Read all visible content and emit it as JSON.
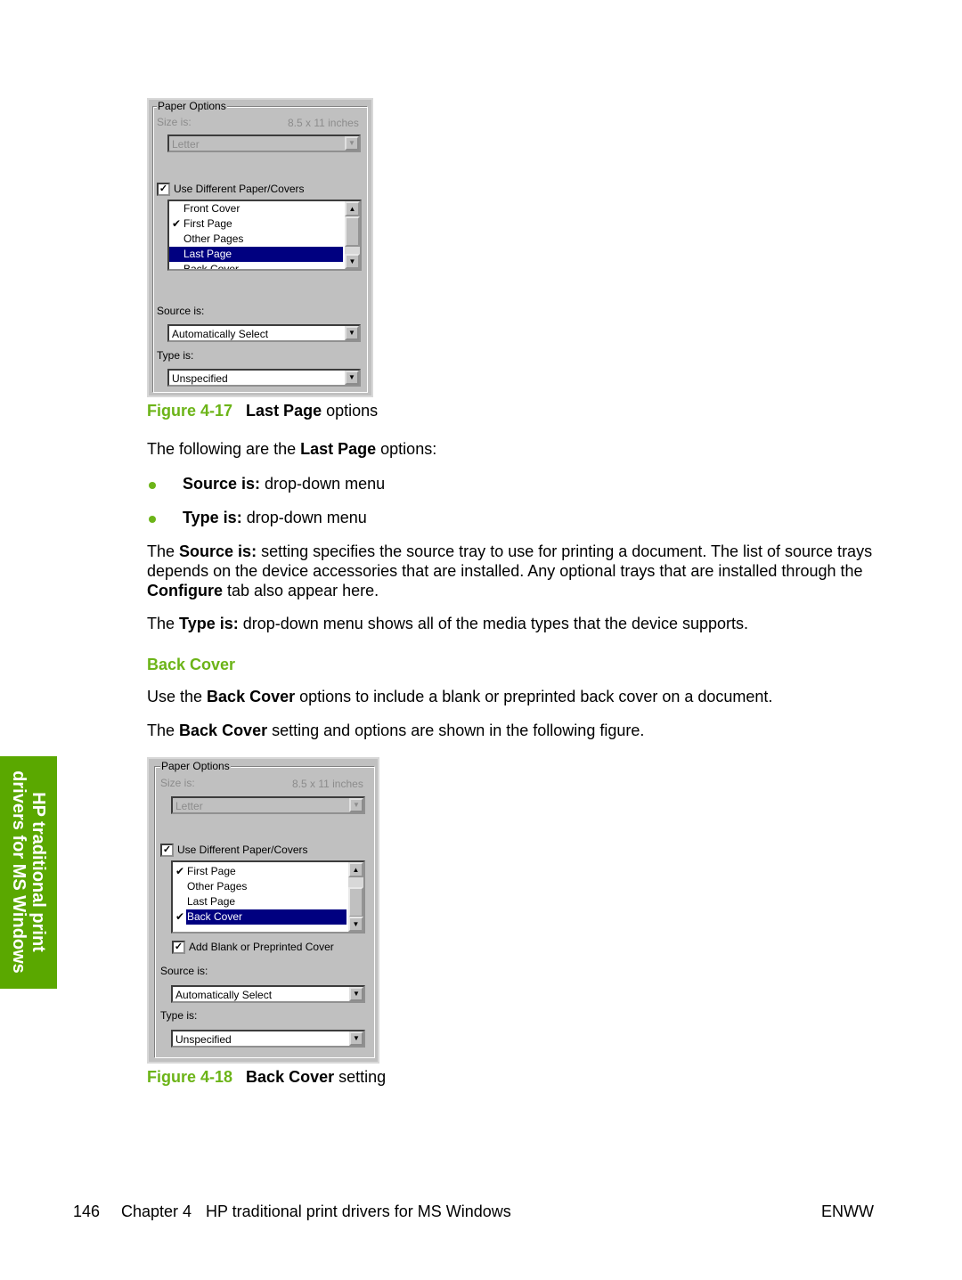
{
  "figure1": {
    "group_title": "Paper Options",
    "size_label": "Size is:",
    "size_value": "8.5 x 11 inches",
    "size_select": "Letter",
    "checkbox_label": "Use Different Paper/Covers",
    "checkbox_checked": true,
    "list_items": [
      {
        "label": "Front Cover",
        "checked": false
      },
      {
        "label": "First Page",
        "checked": true
      },
      {
        "label": "Other Pages",
        "checked": false
      },
      {
        "label": "Last Page",
        "checked": false,
        "selected": true
      },
      {
        "label": "Back Cover",
        "checked": false
      }
    ],
    "source_label": "Source is:",
    "source_value": "Automatically Select",
    "type_label": "Type is:",
    "type_value": "Unspecified",
    "caption_num": "Figure 4-17",
    "caption_bold": "Last Page",
    "caption_rest": " options"
  },
  "body1": {
    "l1": [
      "The following are the ",
      "Last Page",
      " options:"
    ],
    "bullets": [
      [
        "Source is:",
        " drop-down menu"
      ],
      [
        "Type is:",
        " drop-down menu"
      ]
    ],
    "p1": [
      "The ",
      "Source is:",
      " setting specifies the source tray to use for printing a document. The list of source trays",
      "depends on the device accessories that are installed. Any optional trays that are installed through the",
      "Configure",
      " tab also appear here."
    ],
    "p2": [
      "The ",
      "Type is:",
      " drop-down menu shows all of the media types that the device supports."
    ]
  },
  "section": {
    "heading": "Back Cover",
    "p1": [
      "Use the ",
      "Back Cover",
      " options to include a blank or preprinted back cover on a document."
    ],
    "p2": [
      "The ",
      "Back Cover",
      " setting and options are shown in the following figure."
    ]
  },
  "figure2": {
    "group_title": "Paper Options",
    "size_label": "Size is:",
    "size_value": "8.5 x 11 inches",
    "size_select": "Letter",
    "checkbox_label": "Use Different Paper/Covers",
    "checkbox_checked": true,
    "list_items": [
      {
        "label": "First Page",
        "checked": true
      },
      {
        "label": "Other Pages",
        "checked": false
      },
      {
        "label": "Last Page",
        "checked": false
      },
      {
        "label": "Back Cover",
        "checked": true,
        "selected": true
      }
    ],
    "cover_checkbox_label": "Add Blank or Preprinted Cover",
    "cover_checked": true,
    "source_label": "Source is:",
    "source_value": "Automatically Select",
    "type_label": "Type is:",
    "type_value": "Unspecified",
    "caption_num": "Figure 4-18",
    "caption_bold": "Back Cover",
    "caption_rest": " setting"
  },
  "sidetab": {
    "line1": "HP traditional print",
    "line2": "drivers for MS Windows"
  },
  "footer": {
    "page": "146",
    "chapter": "Chapter 4",
    "title": "HP traditional print drivers for MS Windows",
    "code": "ENWW"
  },
  "colors": {
    "accent": "#6cb418",
    "sidetab": "#5aa800",
    "selection": "#000080",
    "dialog": "#c0c0c0"
  }
}
